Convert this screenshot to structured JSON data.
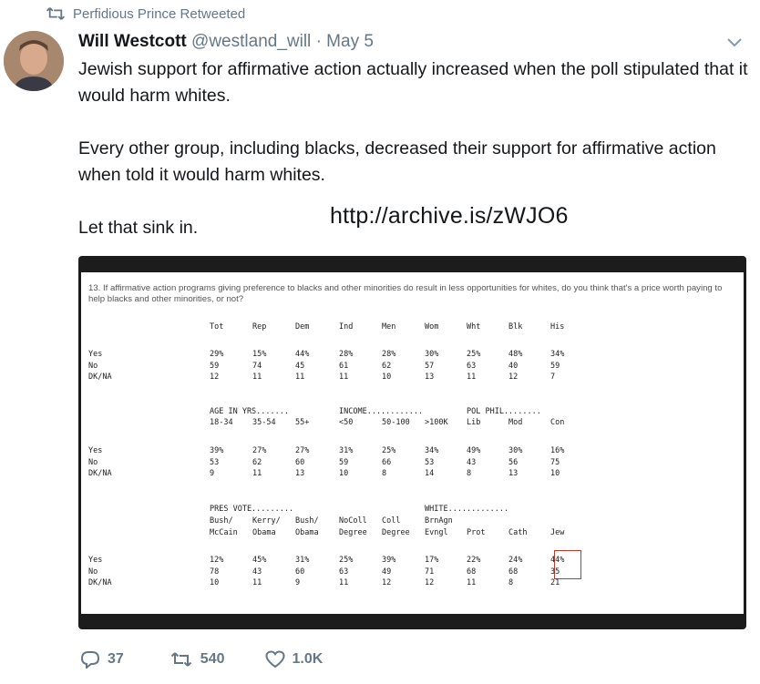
{
  "retweet_line": {
    "text": "Perfidious Prince Retweeted"
  },
  "tweet": {
    "display_name": "Will Westcott",
    "handle": "@westland_will",
    "separator": "·",
    "date": "May 5",
    "paragraphs": [
      "Jewish support for affirmative action actually increased when the poll stipulated that it would harm whites.",
      "Every other group, including blacks, decreased their support for affirmative action when told it would harm whites.",
      "Let that sink in."
    ],
    "overlay_url": "http://archive.is/zWJO6"
  },
  "poll": {
    "question": "13. If affirmative action programs giving preference to blacks and other minorities do result in less opportunities for whites, do you think that's a price worth paying to help blacks and other minorities, or not?",
    "row_labels": [
      "Yes",
      "No",
      "DK/NA"
    ],
    "section1": {
      "headers": [
        "Tot",
        "Rep",
        "Dem",
        "Ind",
        "Men",
        "Wom",
        "Wht",
        "Blk",
        "His"
      ],
      "values": [
        [
          "29%",
          "15%",
          "44%",
          "28%",
          "28%",
          "30%",
          "25%",
          "48%",
          "34%"
        ],
        [
          "59",
          "74",
          "45",
          "61",
          "62",
          "57",
          "63",
          "40",
          "59"
        ],
        [
          "12",
          "11",
          "11",
          "11",
          "10",
          "13",
          "11",
          "12",
          "7"
        ]
      ]
    },
    "section2": {
      "group_headers": [
        "AGE IN YRS.......",
        "INCOME............",
        "POL PHIL........"
      ],
      "headers": [
        "18-34",
        "35-54",
        "55+",
        "<50",
        "50-100",
        ">100K",
        "Lib",
        "Mod",
        "Con"
      ],
      "values": [
        [
          "39%",
          "27%",
          "27%",
          "31%",
          "25%",
          "34%",
          "49%",
          "30%",
          "16%"
        ],
        [
          "53",
          "62",
          "60",
          "59",
          "66",
          "53",
          "43",
          "56",
          "75"
        ],
        [
          "9",
          "11",
          "13",
          "10",
          "8",
          "14",
          "8",
          "13",
          "10"
        ]
      ]
    },
    "section3": {
      "group_headers": [
        "PRES VOTE.........",
        "WHITE............."
      ],
      "headers_line1": [
        "Bush/",
        "Kerry/",
        "Bush/",
        "NoColl",
        "Coll",
        "BrnAgn",
        "",
        "",
        ""
      ],
      "headers_line2": [
        "McCain",
        "Obama",
        "Obama",
        "Degree",
        "Degree",
        "Evngl",
        "Prot",
        "Cath",
        "Jew"
      ],
      "values": [
        [
          "12%",
          "45%",
          "31%",
          "25%",
          "39%",
          "17%",
          "22%",
          "24%",
          "44%"
        ],
        [
          "78",
          "43",
          "60",
          "63",
          "49",
          "71",
          "68",
          "68",
          "35"
        ],
        [
          "10",
          "11",
          "9",
          "11",
          "12",
          "12",
          "11",
          "8",
          "21"
        ]
      ]
    },
    "highlight_color": "#c0392b"
  },
  "actions": {
    "reply_count": "37",
    "retweet_count": "540",
    "like_count": "1.0K"
  },
  "colors": {
    "text": "#14171a",
    "muted": "#657786",
    "media_background": "#1c1c1c"
  },
  "icons": [
    "retweet-icon",
    "chevron-down-icon",
    "reply-icon",
    "like-icon"
  ]
}
